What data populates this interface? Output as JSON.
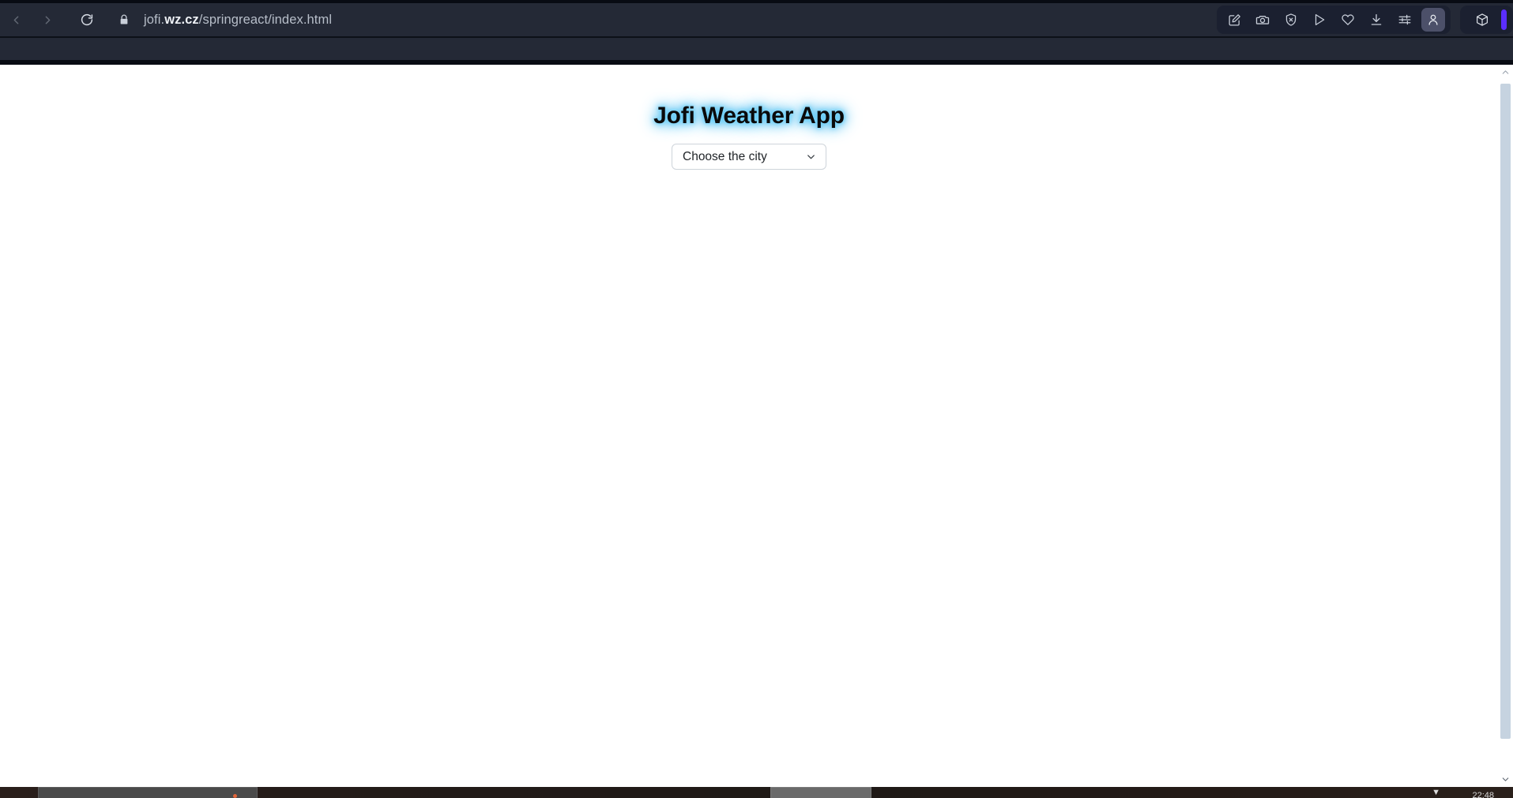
{
  "browser": {
    "url": {
      "prefix": "jofi.",
      "domain": "wz.cz",
      "suffix": "/springreact/index.html",
      "full": "jofi.wz.cz/springreact/index.html"
    },
    "nav": {
      "back_label": "Back",
      "forward_label": "Forward",
      "reload_label": "Reload",
      "site_info_label": "View site information"
    },
    "toolbar_icons": [
      {
        "name": "edit-annotate-icon",
        "label": "Annotate page"
      },
      {
        "name": "camera-icon",
        "label": "Screenshot"
      },
      {
        "name": "shield-block-icon",
        "label": "Tracking protection"
      },
      {
        "name": "send-icon",
        "label": "Send page"
      },
      {
        "name": "heart-icon",
        "label": "Favorites"
      },
      {
        "name": "download-icon",
        "label": "Downloads"
      },
      {
        "name": "sliders-icon",
        "label": "Settings"
      },
      {
        "name": "person-icon",
        "label": "Profile",
        "active": true
      }
    ],
    "extension_icons": [
      {
        "name": "cube-icon",
        "label": "Extension"
      }
    ],
    "accent_color": "#5b2eff",
    "chrome_bg": "#242936"
  },
  "page": {
    "title": "Jofi Weather App",
    "title_color": "#0a0a0a",
    "title_glow_color": "#2fb5ef",
    "city_select": {
      "selected_value": "Choose the city",
      "placeholder": "Choose the city",
      "chevron_icon": "chevron-down-icon",
      "options": [
        "Choose the city"
      ]
    },
    "background_color": "#ffffff"
  },
  "scrollbar": {
    "up_arrow_icon": "chevron-up-icon",
    "down_arrow_icon": "chevron-down-icon",
    "thumb_color": "#c6d3e0"
  },
  "taskbar": {
    "clock": "22:48"
  }
}
